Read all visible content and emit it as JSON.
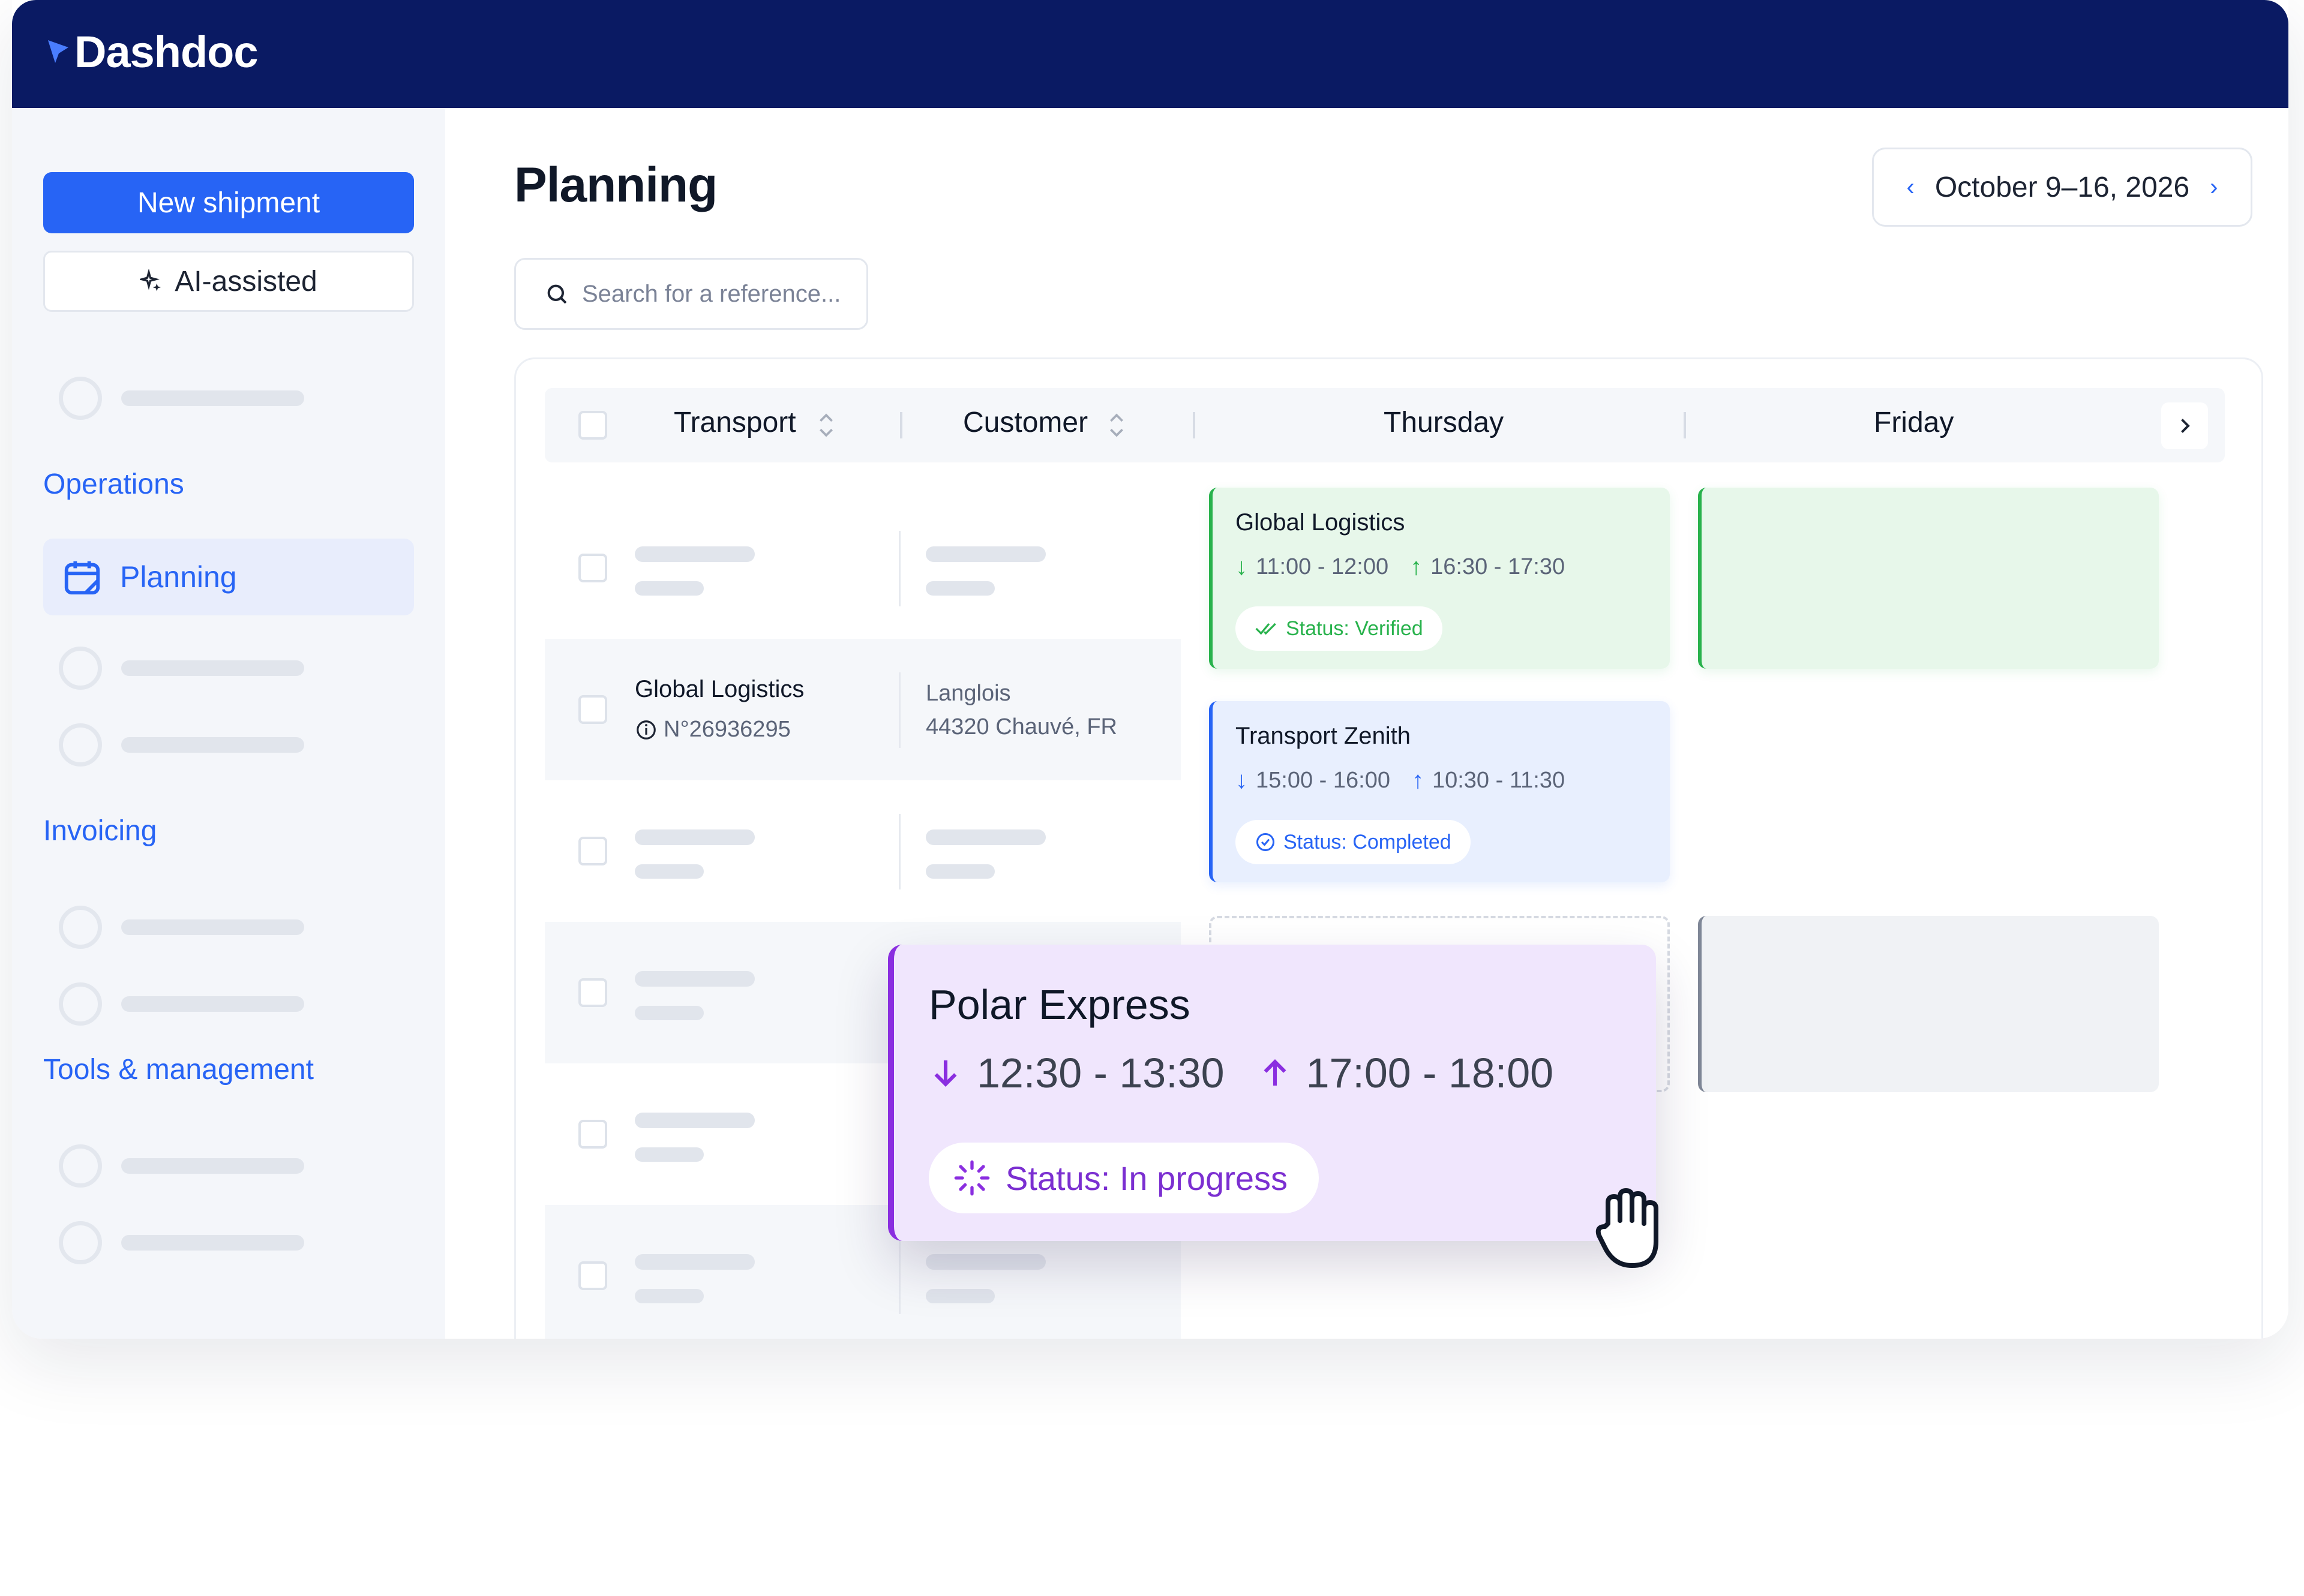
{
  "brand": {
    "name": "Dashdoc"
  },
  "sidebar": {
    "new_shipment": "New shipment",
    "ai_assisted": "AI-assisted",
    "sections": {
      "operations": "Operations",
      "invoicing": "Invoicing",
      "tools": "Tools & management"
    },
    "active_item": "Planning"
  },
  "main": {
    "title": "Planning",
    "search_placeholder": "Search for a reference...",
    "date_range": "October 9–16, 2026",
    "columns": {
      "transport": "Transport",
      "customer": "Customer"
    },
    "days": [
      "Thursday",
      "Friday"
    ]
  },
  "rows": [
    {
      "transport": "Global Logistics",
      "reference": "N°26936295",
      "customer_name": "Langlois",
      "customer_address": "44320 Chauvé, FR"
    }
  ],
  "events": {
    "global_logistics": {
      "title": "Global Logistics",
      "pickup": "11:00 - 12:00",
      "delivery": "16:30 - 17:30",
      "status": "Status: Verified"
    },
    "transport_zenith": {
      "title": "Transport Zenith",
      "pickup": "15:00 - 16:00",
      "delivery": "10:30 - 11:30",
      "status": "Status: Completed"
    },
    "polar_express": {
      "title": "Polar Express",
      "pickup": "12:30 - 13:30",
      "delivery": "17:00 - 18:00",
      "status": "Status: In progress"
    }
  },
  "colors": {
    "topbar": "#0a1a63",
    "accent": "#2764f5",
    "verified": "#28b24c",
    "in_progress": "#8a2ee0"
  },
  "icons": [
    "brand-flag-icon",
    "sparkle-icon",
    "calendar-icon",
    "search-icon",
    "sort-icon",
    "chevron-left-icon",
    "chevron-right-icon",
    "info-icon",
    "arrow-down-icon",
    "arrow-up-icon",
    "check-icon",
    "loader-icon",
    "grab-hand-icon"
  ]
}
